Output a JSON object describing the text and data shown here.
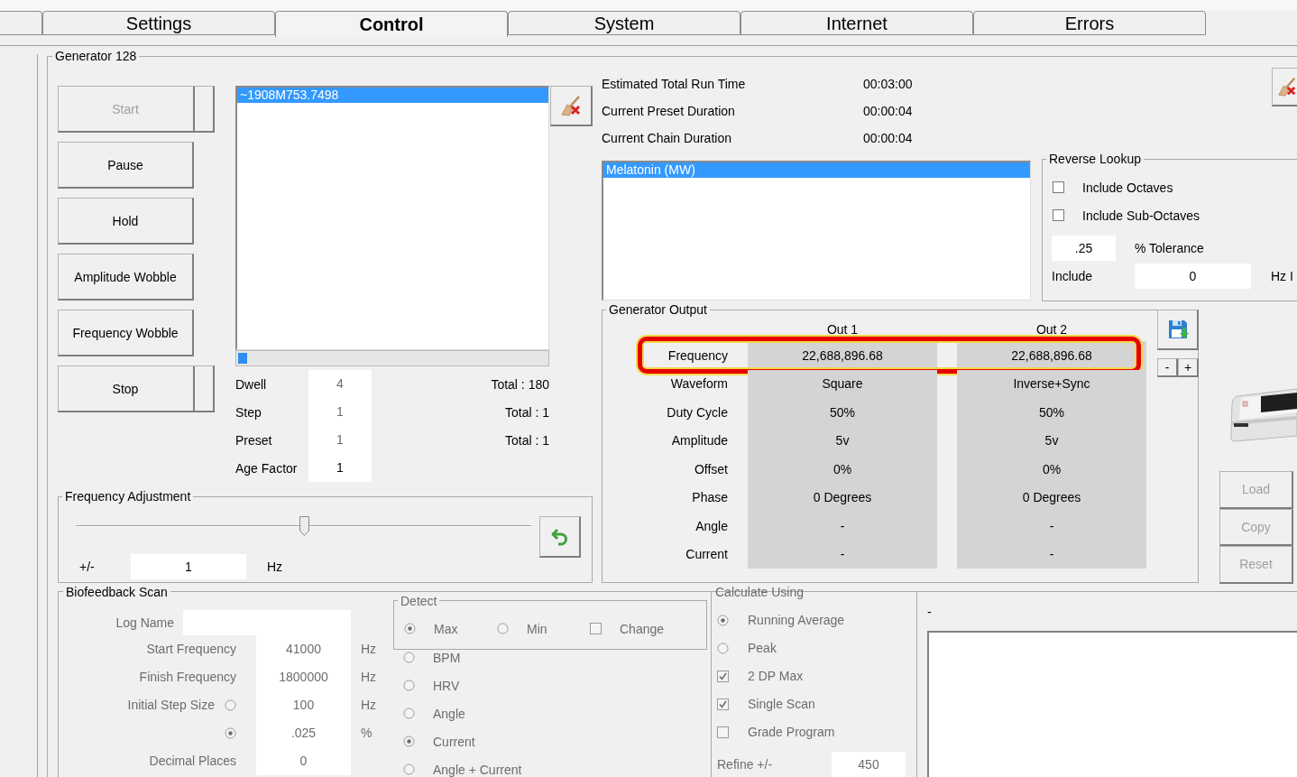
{
  "tabs": [
    {
      "label": "Settings",
      "selected": false
    },
    {
      "label": "Control",
      "selected": true
    },
    {
      "label": "System",
      "selected": false
    },
    {
      "label": "Internet",
      "selected": false
    },
    {
      "label": "Errors",
      "selected": false
    }
  ],
  "generator": {
    "title": "Generator 128",
    "buttons": [
      {
        "label": "Start",
        "kind": "split",
        "disabled": true
      },
      {
        "label": "Pause",
        "kind": "plain",
        "disabled": false
      },
      {
        "label": "Hold",
        "kind": "plain",
        "disabled": false
      },
      {
        "label": "Amplitude Wobble",
        "kind": "plain",
        "disabled": false
      },
      {
        "label": "Frequency Wobble",
        "kind": "plain",
        "disabled": false
      },
      {
        "label": "Stop",
        "kind": "split",
        "disabled": false
      }
    ],
    "program_list": [
      {
        "label": "~1908M753.7498",
        "selected": true
      }
    ],
    "progress": {
      "level": 0.03
    },
    "counters": [
      {
        "label": "Dwell",
        "value": "4",
        "disabled": true,
        "total": "Total : 180"
      },
      {
        "label": "Step",
        "value": "1",
        "disabled": true,
        "total": "Total : 1"
      },
      {
        "label": "Preset",
        "value": "1",
        "disabled": true,
        "total": "Total : 1"
      },
      {
        "label": "Age Factor",
        "value": "1",
        "disabled": false
      }
    ],
    "frequency_adjustment": {
      "title": "Frequency Adjustment",
      "level": 0.5,
      "offset_label": "+/-",
      "offset_value": "1",
      "unit": "Hz"
    },
    "timings": [
      {
        "label": "Estimated Total Run Time",
        "value": "00:03:00"
      },
      {
        "label": "Current Preset Duration",
        "value": "00:00:04"
      },
      {
        "label": "Current Chain Duration",
        "value": "00:00:04"
      }
    ],
    "preset_list": [
      {
        "label": "Melatonin (MW)",
        "selected": true
      }
    ],
    "reverse_lookup": {
      "title": "Reverse Lookup",
      "options": [
        {
          "label": "Include Octaves",
          "checked": false
        },
        {
          "label": "Include Sub-Octaves",
          "checked": false
        }
      ],
      "tolerance": {
        "value": ".25",
        "label": "% Tolerance"
      },
      "include": {
        "label": "Include",
        "value": "0",
        "unit": "Hz I"
      }
    },
    "output": {
      "title": "Generator Output",
      "columns": [
        "Out 1",
        "Out 2"
      ],
      "rows": [
        {
          "label": "Frequency",
          "values": [
            "22,688,896.68",
            "22,688,896.68"
          ],
          "highlighted": true
        },
        {
          "label": "Waveform",
          "values": [
            "Square",
            "Inverse+Sync"
          ],
          "highlighted": false
        },
        {
          "label": "Duty Cycle",
          "values": [
            "50%",
            "50%"
          ],
          "highlighted": false
        },
        {
          "label": "Amplitude",
          "values": [
            "5v",
            "5v"
          ],
          "highlighted": false
        },
        {
          "label": "Offset",
          "values": [
            "0%",
            "0%"
          ],
          "highlighted": false
        },
        {
          "label": "Phase",
          "values": [
            "0 Degrees",
            "0 Degrees"
          ],
          "highlighted": false
        },
        {
          "label": "Angle",
          "values": [
            "-",
            "-"
          ],
          "highlighted": false
        },
        {
          "label": "Current",
          "values": [
            "-",
            "-"
          ],
          "highlighted": false
        }
      ],
      "step_buttons": [
        "-",
        "+"
      ]
    },
    "side_buttons": [
      {
        "label": "Load",
        "disabled": true
      },
      {
        "label": "Copy",
        "disabled": true
      },
      {
        "label": "Reset",
        "disabled": true
      }
    ],
    "biofeedback": {
      "title": "Biofeedback Scan",
      "disabled": true,
      "log_name": {
        "label": "Log Name"
      },
      "frequencies": [
        {
          "label": "Start Frequency",
          "value": "41000",
          "unit": "Hz"
        },
        {
          "label": "Finish Frequency",
          "value": "1800000",
          "unit": "Hz"
        }
      ],
      "step_size": {
        "label": "Initial Step Size",
        "options": [
          {
            "selected": false,
            "value": "100",
            "unit": "Hz"
          },
          {
            "selected": true,
            "value": ".025",
            "unit": "%"
          }
        ]
      },
      "decimal_places": {
        "label": "Decimal Places",
        "value": "0"
      },
      "detect": {
        "title": "Detect",
        "modes": [
          {
            "label": "Max",
            "selected": true
          },
          {
            "label": "Min",
            "selected": false
          }
        ],
        "change": {
          "label": "Change",
          "checked": false
        },
        "signals": [
          {
            "label": "BPM",
            "selected": false
          },
          {
            "label": "HRV",
            "selected": false
          },
          {
            "label": "Angle",
            "selected": false
          },
          {
            "label": "Current",
            "selected": true
          },
          {
            "label": "Angle + Current",
            "selected": false
          }
        ]
      },
      "calculate": {
        "title": "Calculate Using",
        "methods": [
          {
            "label": "Running Average",
            "selected": true
          },
          {
            "label": "Peak",
            "selected": false
          }
        ],
        "options": [
          {
            "label": "2 DP Max",
            "checked": true
          },
          {
            "label": "Single Scan",
            "checked": true
          },
          {
            "label": "Grade Program",
            "checked": false
          }
        ],
        "refine": {
          "label": "Refine +/-",
          "value": "450"
        }
      }
    },
    "log": {
      "label": "-"
    }
  }
}
